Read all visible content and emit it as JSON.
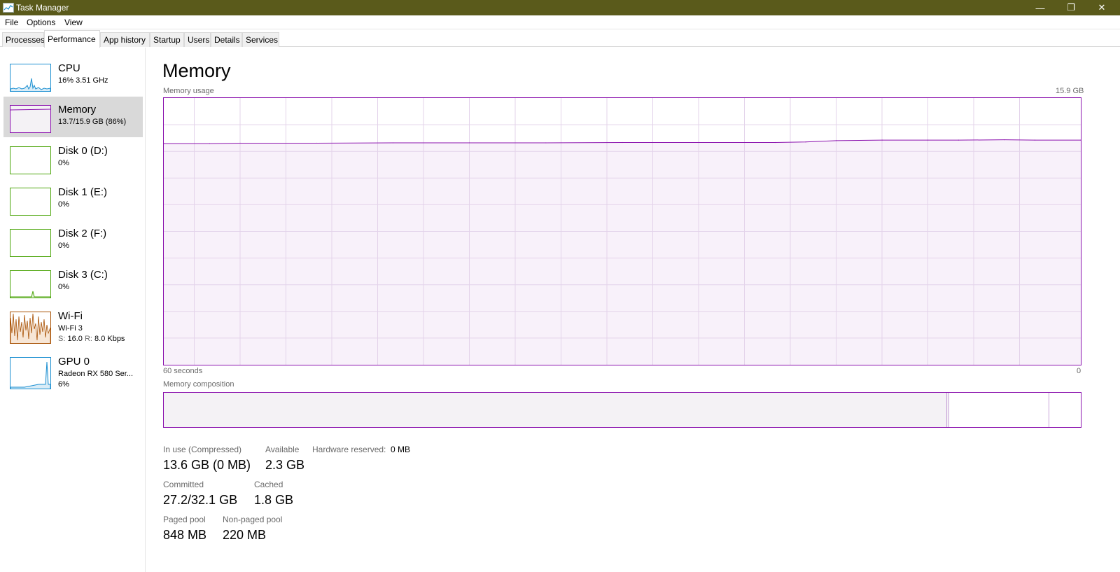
{
  "window": {
    "title": "Task Manager",
    "minimize_glyph": "—",
    "restore_glyph": "❐",
    "close_glyph": "✕"
  },
  "menu": [
    "File",
    "Options",
    "View"
  ],
  "tabs": [
    {
      "label": "Processes",
      "active": false
    },
    {
      "label": "Performance",
      "active": true
    },
    {
      "label": "App history",
      "active": false
    },
    {
      "label": "Startup",
      "active": false
    },
    {
      "label": "Users",
      "active": false
    },
    {
      "label": "Details",
      "active": false
    },
    {
      "label": "Services",
      "active": false
    }
  ],
  "sidebar": {
    "items": [
      {
        "name": "CPU",
        "sub": "16% 3.51 GHz",
        "color": "#1b8fd1",
        "selected": false
      },
      {
        "name": "Memory",
        "sub": "13.7/15.9 GB (86%)",
        "color": "#8b12ae",
        "selected": true
      },
      {
        "name": "Disk 0 (D:)",
        "sub": "0%",
        "color": "#4da60c",
        "selected": false
      },
      {
        "name": "Disk 1 (E:)",
        "sub": "0%",
        "color": "#4da60c",
        "selected": false
      },
      {
        "name": "Disk 2 (F:)",
        "sub": "0%",
        "color": "#4da60c",
        "selected": false
      },
      {
        "name": "Disk 3 (C:)",
        "sub": "0%",
        "color": "#4da60c",
        "selected": false
      },
      {
        "name": "Wi-Fi",
        "sub": "Wi-Fi 3",
        "sub2_s_label": "S:",
        "sub2_s_value": "16.0",
        "sub2_r_label": "R:",
        "sub2_r_value": "8.0 Kbps",
        "color": "#a74f01",
        "selected": false
      },
      {
        "name": "GPU 0",
        "sub": "Radeon RX 580 Ser...",
        "sub2": "6%",
        "color": "#1b8fd1",
        "selected": false
      }
    ]
  },
  "main": {
    "title": "Memory",
    "usage_label": "Memory usage",
    "usage_max": "15.9 GB",
    "time_left": "60 seconds",
    "time_right": "0",
    "composition_label": "Memory composition",
    "accent_color": "#8b12ae",
    "stats": {
      "in_use_label": "In use (Compressed)",
      "in_use_value": "13.6 GB (0 MB)",
      "available_label": "Available",
      "available_value": "2.3 GB",
      "hw_reserved_label": "Hardware reserved:",
      "hw_reserved_value": "0 MB",
      "committed_label": "Committed",
      "committed_value": "27.2/32.1 GB",
      "cached_label": "Cached",
      "cached_value": "1.8 GB",
      "paged_label": "Paged pool",
      "paged_value": "848 MB",
      "nonpaged_label": "Non-paged pool",
      "nonpaged_value": "220 MB"
    }
  },
  "chart_data": {
    "type": "area",
    "title": "Memory usage",
    "xlabel": "60 seconds",
    "ylabel": "",
    "xlim": [
      60,
      0
    ],
    "ylim": [
      0,
      15.9
    ],
    "grid": true,
    "x": [
      60,
      57,
      55,
      50,
      45,
      40,
      35,
      30,
      25,
      20,
      18,
      16,
      13,
      10,
      8,
      5,
      3,
      0
    ],
    "series": [
      {
        "values": [
          13.18,
          13.18,
          13.21,
          13.21,
          13.23,
          13.23,
          13.23,
          13.25,
          13.25,
          13.25,
          13.28,
          13.36,
          13.39,
          13.39,
          13.39,
          13.41,
          13.39,
          13.39
        ]
      }
    ]
  }
}
